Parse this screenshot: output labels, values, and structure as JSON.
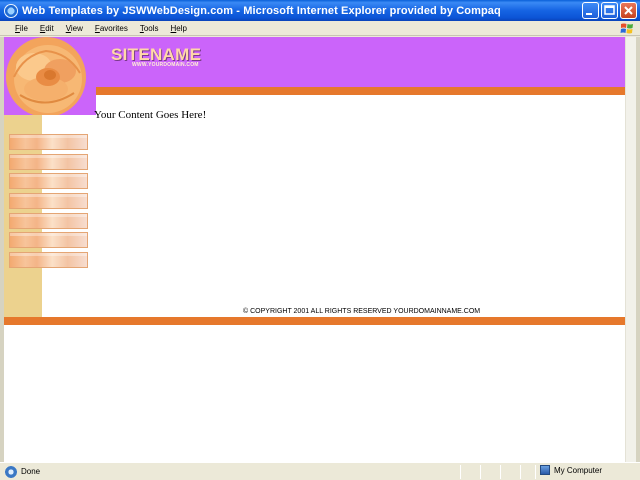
{
  "window": {
    "title": "Web Templates by JSWWebDesign.com - Microsoft Internet Explorer provided by Compaq",
    "minimize_icon": "minimize-icon",
    "maximize_icon": "maximize-icon",
    "close_icon": "close-icon"
  },
  "menu": {
    "items": [
      "File",
      "Edit",
      "View",
      "Favorites",
      "Tools",
      "Help"
    ]
  },
  "page": {
    "sitename": "SITENAME",
    "domain": "WWW.YOURDOMAIN.COM",
    "content": "Your Content Goes Here!",
    "nav_button_count": 7,
    "copyright": "© COPYRIGHT 2001 ALL RIGHTS RESERVED YOURDOMAINNAME.COM",
    "colors": {
      "header": "#cb64fa",
      "accent_bar": "#e6782c",
      "left_strip": "#ecd28e"
    }
  },
  "status": {
    "text": "Done",
    "zone": "My Computer"
  }
}
